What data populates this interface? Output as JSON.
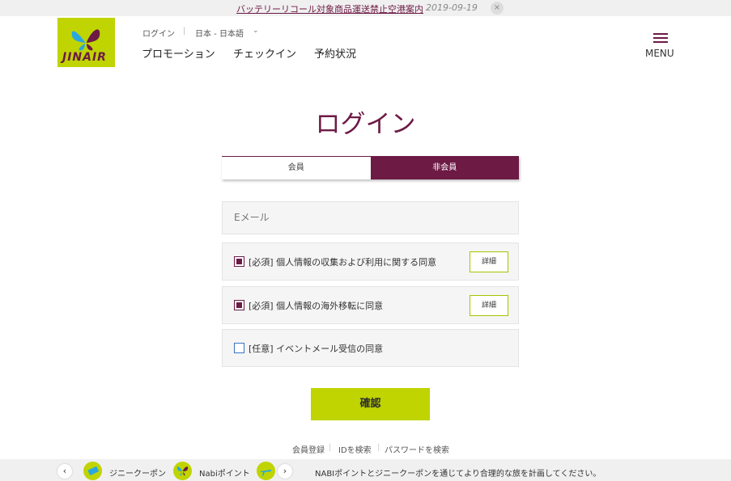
{
  "notice": {
    "text": "バッテリーリコール対象商品運送禁止空港案内",
    "date": "2019-09-19",
    "close": "×"
  },
  "brand": {
    "logo_text": "JINAIR"
  },
  "utility": {
    "login": "ログイン",
    "separator": "|",
    "language": "日本 - 日本語",
    "caret": "⌄"
  },
  "nav": {
    "promotion": "プロモーション",
    "checkin": "チェックイン",
    "reservation": "予約状況"
  },
  "menu": {
    "label": "MENU"
  },
  "page": {
    "title": "ログイン"
  },
  "tabs": [
    {
      "label": "会員",
      "active": false
    },
    {
      "label": "非会員",
      "active": true
    }
  ],
  "form": {
    "email_placeholder": "Eメール",
    "agreements": [
      {
        "text": "[必須] 個人情報の収集および利用に関する同意",
        "checked": true,
        "detail": "詳細"
      },
      {
        "text": "[必須] 個人情報の海外移転に同意",
        "checked": true,
        "detail": "詳細"
      },
      {
        "text": "[任意] イベントメール受信の同意",
        "checked": false
      }
    ],
    "confirm": "確認"
  },
  "links": {
    "register": "会員登録",
    "find_id": "IDを検索",
    "find_password": "パスワードを検索",
    "separator": "|"
  },
  "bottom_bar": {
    "prev": "‹",
    "next": "›",
    "coupon": "ジニークーポン",
    "nabi": "Nabiポイント",
    "message": "NABIポイントとジニークーポンを通じてより合理的な旅を計画してください。"
  },
  "colors": {
    "brand_purple": "#6d1a45",
    "brand_lime": "#bfd400",
    "checkbox_blue": "#3d73c4"
  }
}
